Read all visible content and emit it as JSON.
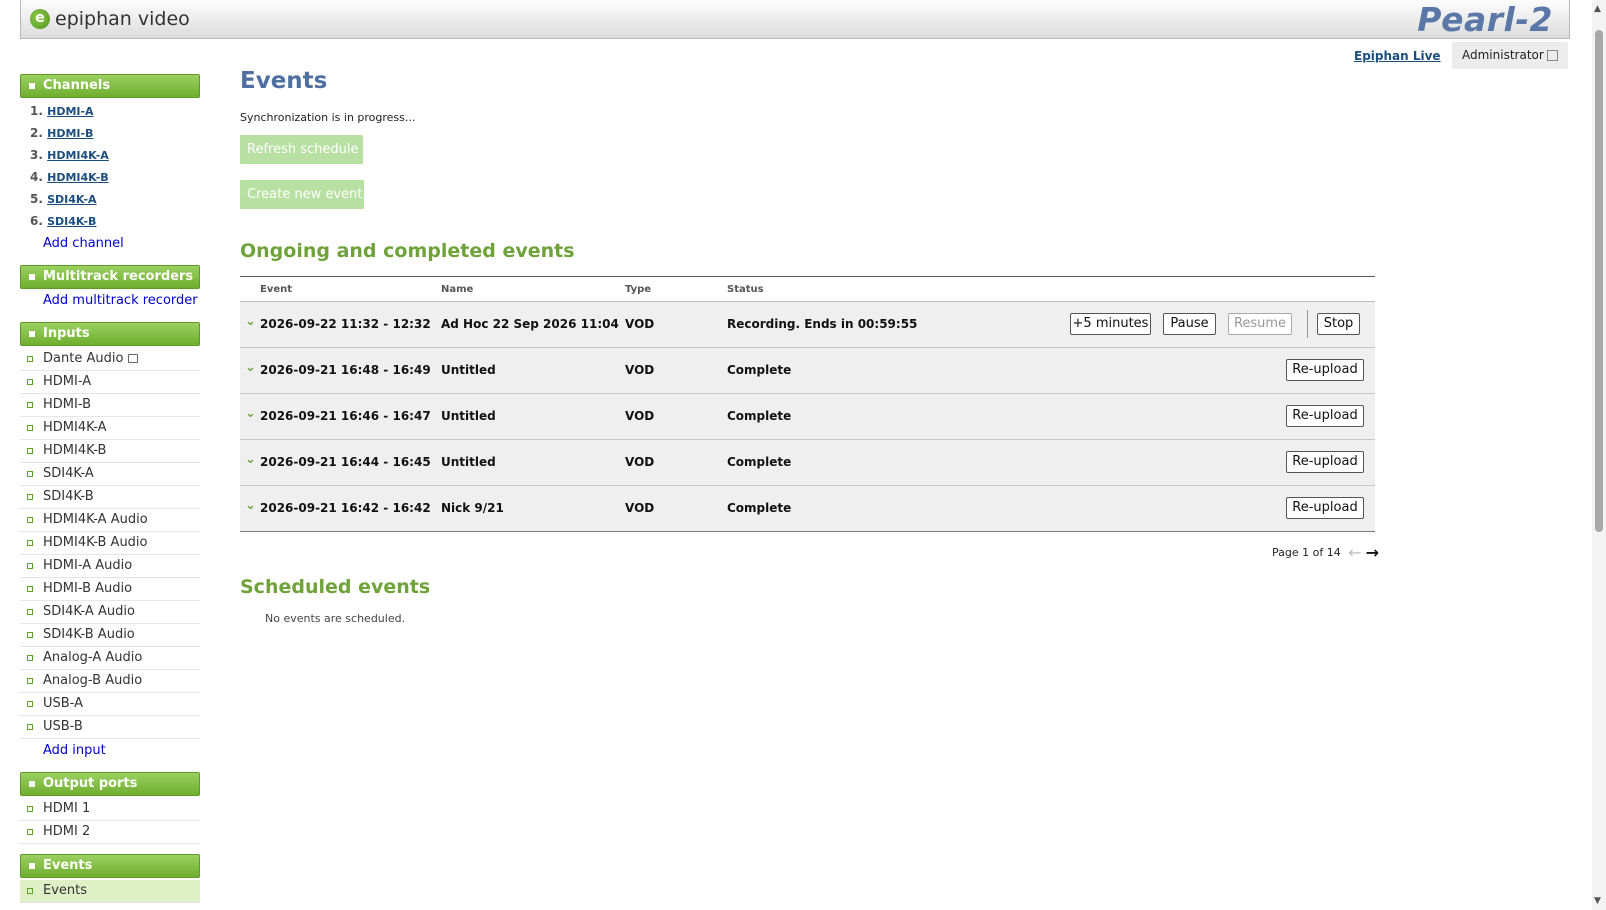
{
  "header": {
    "brand": "epiphan video",
    "product": "Pearl-2"
  },
  "topbar": {
    "live_link": "Epiphan Live",
    "user": "Administrator"
  },
  "sidebar": {
    "channels": {
      "title": "Channels",
      "items": [
        {
          "num": "1.",
          "label": "HDMI-A"
        },
        {
          "num": "2.",
          "label": "HDMI-B"
        },
        {
          "num": "3.",
          "label": "HDMI4K-A"
        },
        {
          "num": "4.",
          "label": "HDMI4K-B"
        },
        {
          "num": "5.",
          "label": "SDI4K-A"
        },
        {
          "num": "6.",
          "label": "SDI4K-B"
        }
      ],
      "add": "Add channel"
    },
    "multitrack": {
      "title": "Multitrack recorders",
      "add": "Add multitrack recorder"
    },
    "inputs": {
      "title": "Inputs",
      "items": [
        "Dante Audio",
        "HDMI-A",
        "HDMI-B",
        "HDMI4K-A",
        "HDMI4K-B",
        "SDI4K-A",
        "SDI4K-B",
        "HDMI4K-A Audio",
        "HDMI4K-B Audio",
        "HDMI-A Audio",
        "HDMI-B Audio",
        "SDI4K-A Audio",
        "SDI4K-B Audio",
        "Analog-A Audio",
        "Analog-B Audio",
        "USB-A",
        "USB-B"
      ],
      "add": "Add input"
    },
    "outputs": {
      "title": "Output ports",
      "items": [
        "HDMI 1",
        "HDMI 2"
      ]
    },
    "events": {
      "title": "Events",
      "items": [
        "Events"
      ]
    }
  },
  "main": {
    "title": "Events",
    "sync_status": "Synchronization is in progress...",
    "refresh_button": "Refresh schedule",
    "create_button": "Create new event",
    "ongoing_heading": "Ongoing and completed events",
    "table": {
      "headers": {
        "event": "Event",
        "name": "Name",
        "type": "Type",
        "status": "Status"
      },
      "rows": [
        {
          "event": "2026-09-22 11:32 - 12:32",
          "name": "Ad Hoc 22 Sep 2026 11:04",
          "type": "VOD",
          "status": "Recording. Ends in 00:59:55"
        },
        {
          "event": "2026-09-21 16:48 - 16:49",
          "name": "Untitled",
          "type": "VOD",
          "status": "Complete"
        },
        {
          "event": "2026-09-21 16:46 - 16:47",
          "name": "Untitled",
          "type": "VOD",
          "status": "Complete"
        },
        {
          "event": "2026-09-21 16:44 - 16:45",
          "name": "Untitled",
          "type": "VOD",
          "status": "Complete"
        },
        {
          "event": "2026-09-21 16:42 - 16:42",
          "name": "Nick 9/21",
          "type": "VOD",
          "status": "Complete"
        }
      ],
      "actions": {
        "plus5": "+5 minutes",
        "pause": "Pause",
        "resume": "Resume",
        "stop": "Stop",
        "reupload": "Re-upload"
      }
    },
    "pager": {
      "text": "Page 1 of 14"
    },
    "scheduled_heading": "Scheduled events",
    "no_scheduled": "No events are scheduled."
  }
}
